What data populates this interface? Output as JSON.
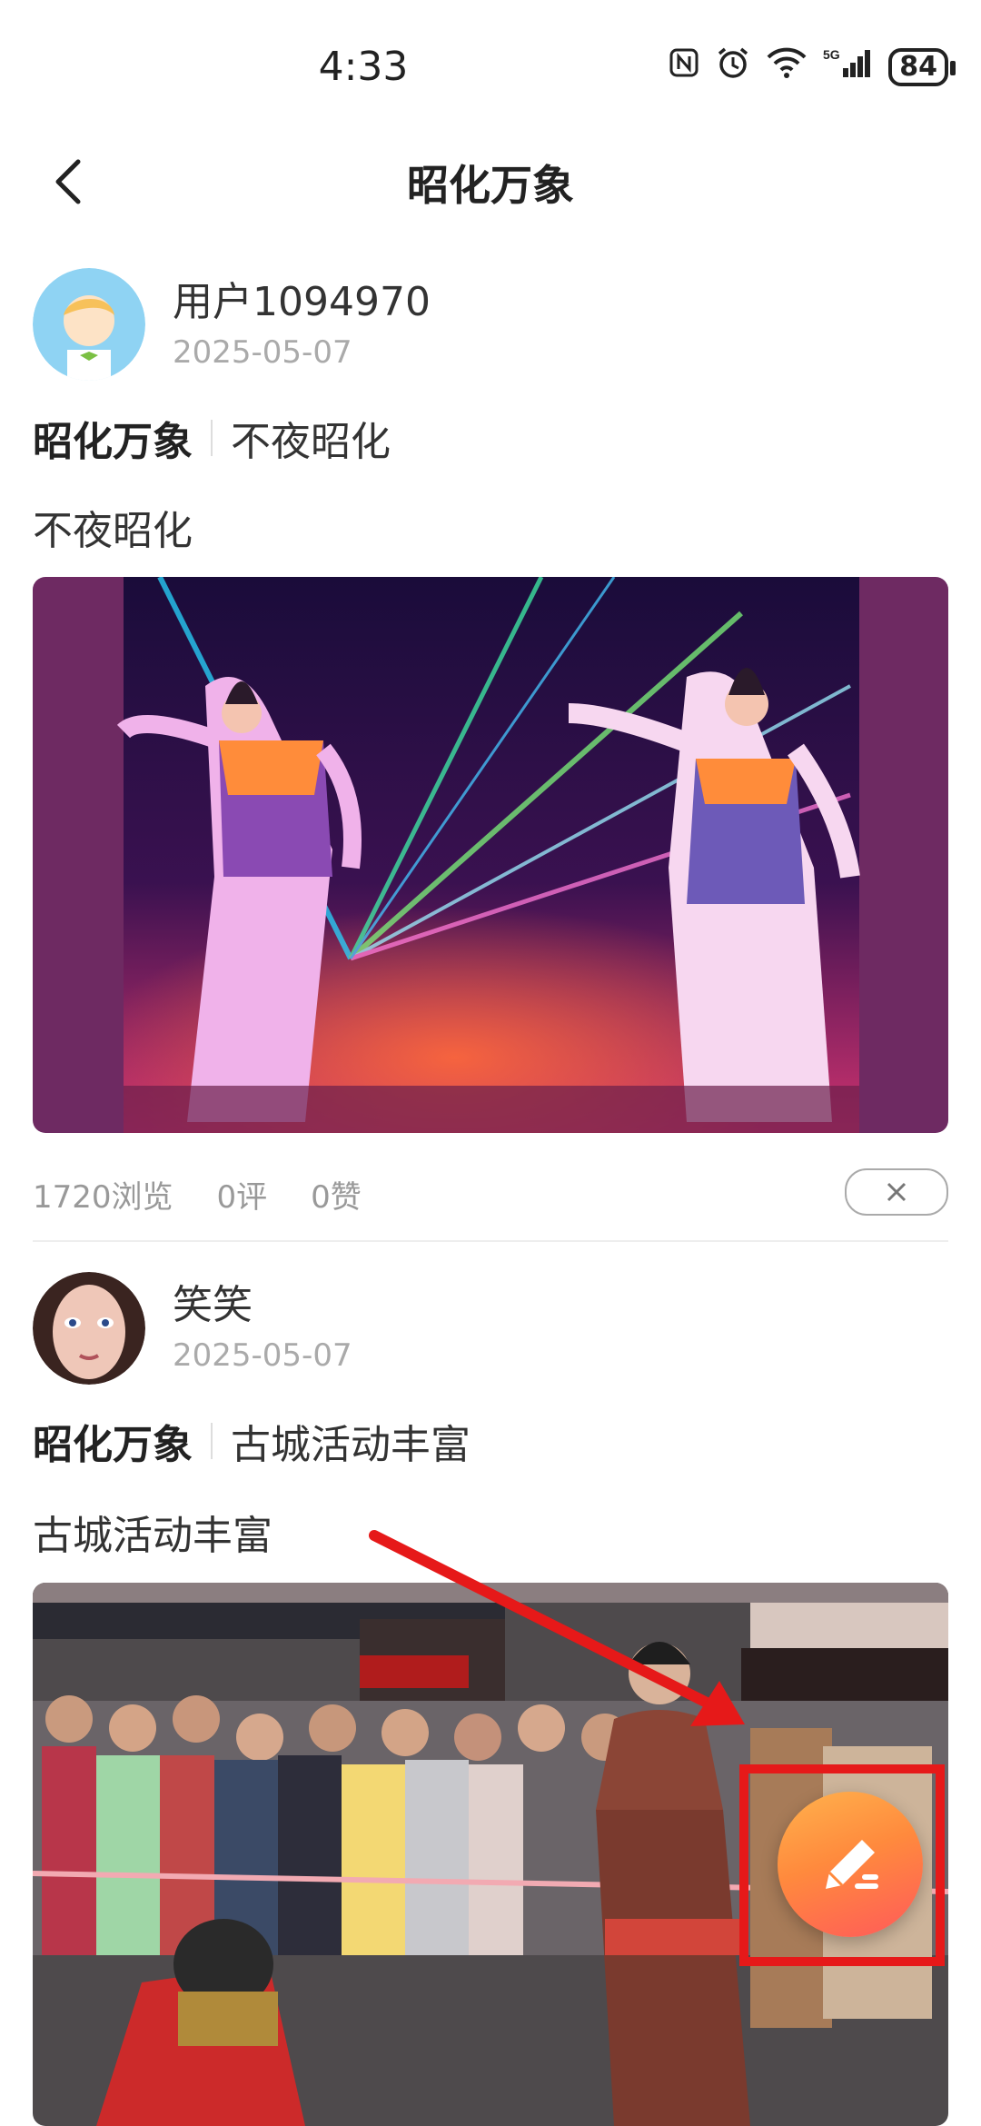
{
  "status_bar": {
    "time": "4:33",
    "battery": "84",
    "icons": [
      "nfc-icon",
      "alarm-icon",
      "wifi-icon",
      "signal-5g-icon"
    ]
  },
  "header": {
    "title": "昭化万象",
    "back_icon": "chevron-left-icon"
  },
  "posts": [
    {
      "username": "用户1094970",
      "date": "2025-05-07",
      "topic": "昭化万象",
      "topic_title": "不夜昭化",
      "text": "不夜昭化",
      "views": "1720浏览",
      "comments": "0评",
      "likes": "0赞",
      "close_icon": "close-icon"
    },
    {
      "username": "笑笑",
      "date": "2025-05-07",
      "topic": "昭化万象",
      "topic_title": "古城活动丰富",
      "text": "古城活动丰富"
    }
  ],
  "fab": {
    "icon": "pencil-icon"
  },
  "annotation_color": "#e61919"
}
